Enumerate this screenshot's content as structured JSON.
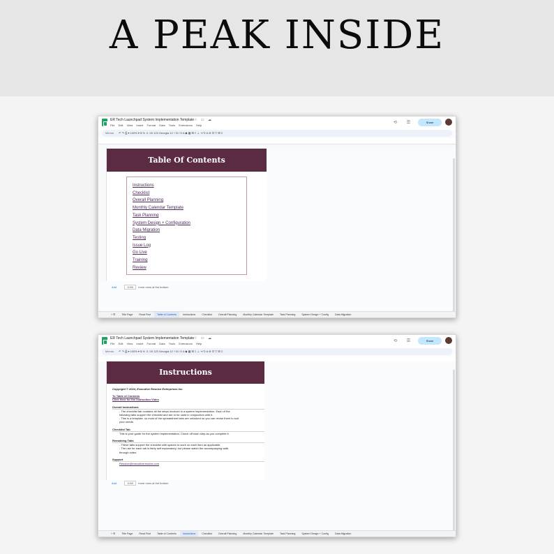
{
  "headline": "A PEAK INSIDE",
  "doc_title": "ER Tech Launchpad System Implementation Template",
  "menu": [
    "File",
    "Edit",
    "View",
    "Insert",
    "Format",
    "Data",
    "Tools",
    "Extensions",
    "Help"
  ],
  "toolbar": {
    "menus_label": "Menus",
    "zoom": "100%",
    "font": "Georgia",
    "font_size": "12"
  },
  "share_label": "Share",
  "window1": {
    "header": "Table Of Contents",
    "toc": [
      "Instructions",
      "Checklist",
      "Overall Planning",
      "Monthly Calendar Template",
      "Task Planning",
      "System Design + Configuration",
      "Data Migration",
      "Testing",
      "Issue Log",
      "Go Live",
      "Training",
      "Review"
    ],
    "active_tab": "Table of Contents"
  },
  "window2": {
    "header": "Instructions",
    "copyright": "Copyright © 2024, Executive Resolve Enterprises Inc.",
    "link_toc": "To Table of Contents",
    "link_video": "Click Here for the Instruction Video",
    "overall_heading": "Overall Instructions",
    "overall_lines": [
      "- The checklist tab contains all the steps involved in a system implementation. Each of the",
      "following tabs support the checklist and are to be used in conjunction with it.",
      "- This is a template, so most of the spreadsheet tabs are unlocked so you can revise them to suit",
      "your needs."
    ],
    "checklist_heading": "Checklist Tab",
    "checklist_line": "This is your guide for the system implementation. Check off each step as you complete it.",
    "remaining_heading": "Remaining Tabs",
    "remaining_lines": [
      "- These tabs support the checklist with spaces to work on each item as applicable.",
      "- The use for each tab is fairly self explanatory, but please watch the accompanying walk",
      "through video."
    ],
    "support_heading": "Support",
    "support_email": "Resolve@executiveresolve.com",
    "active_tab": "Instructions"
  },
  "add_rows": {
    "add": "Add",
    "count": "1000",
    "suffix": "more rows at the bottom"
  },
  "tabs": [
    "Title Page",
    "Read First",
    "Table of Contents",
    "Instructions",
    "Checklist",
    "Overall Planning",
    "Monthly Calendar Template",
    "Task Planning",
    "System Design + Config",
    "Data Migration"
  ],
  "colors": {
    "header_bg": "#5a2b42",
    "link": "#4b2a57",
    "share_bg": "#c2e7ff",
    "sheets_green": "#1ea362"
  }
}
